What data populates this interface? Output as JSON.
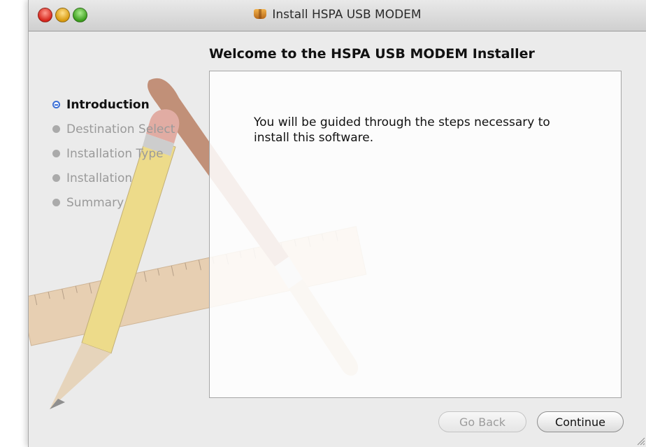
{
  "window": {
    "title": "Install HSPA USB MODEM",
    "title_icon": "package-icon"
  },
  "heading": "Welcome to the HSPA USB MODEM Installer",
  "steps": [
    {
      "label": "Introduction",
      "state": "current"
    },
    {
      "label": "Destination Select",
      "state": "pending"
    },
    {
      "label": "Installation Type",
      "state": "pending"
    },
    {
      "label": "Installation",
      "state": "pending"
    },
    {
      "label": "Summary",
      "state": "pending"
    }
  ],
  "body_text": "You will be guided through the steps necessary to install this software.",
  "buttons": {
    "go_back": {
      "label": "Go Back",
      "enabled": false
    },
    "continue": {
      "label": "Continue",
      "enabled": true
    }
  },
  "colors": {
    "current_step_accent": "#3b6fd6",
    "window_background": "#ebebeb"
  }
}
